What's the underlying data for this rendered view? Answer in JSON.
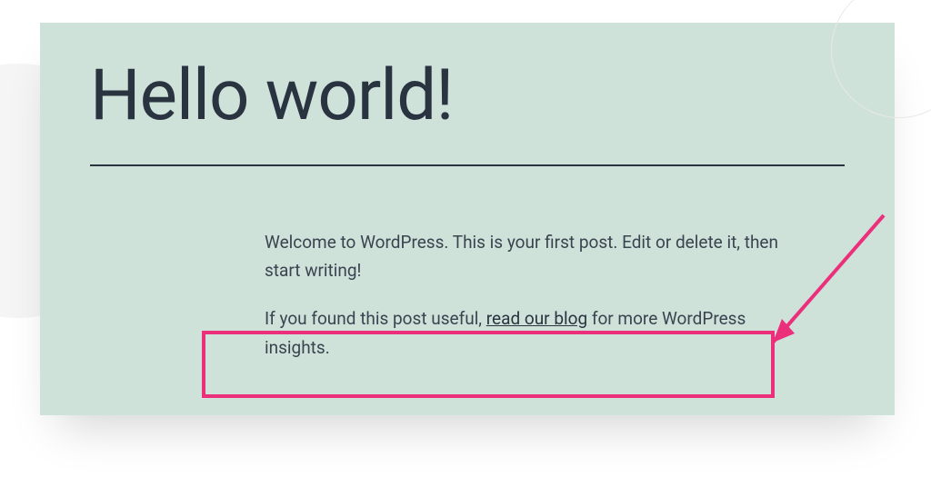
{
  "post": {
    "title": "Hello world!",
    "intro_text": "Welcome to WordPress. This is your first post. Edit or delete it, then start writing!",
    "cta_prefix": "If you found this post useful, ",
    "cta_link_text": "read our blog",
    "cta_suffix": " for more WordPress insights."
  },
  "annotation": {
    "highlight_color": "#ec2f7b"
  }
}
